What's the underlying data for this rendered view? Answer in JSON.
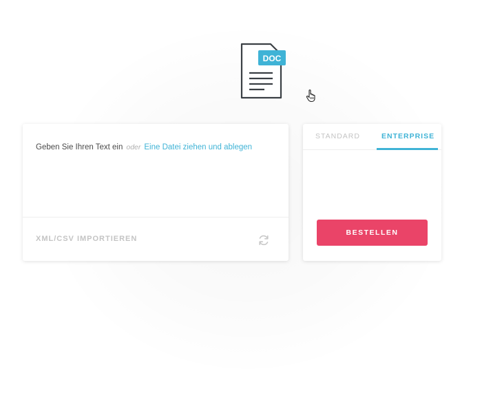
{
  "header": {
    "doc_icon": "document-icon",
    "doc_badge": "DOC"
  },
  "cursor": {
    "icon": "hand-pointer-icon"
  },
  "input_panel": {
    "prompt": "Geben Sie Ihren Text ein",
    "or": "oder",
    "drop_link": "Eine Datei ziehen und ablegen",
    "import_link": "XML/CSV IMPORTIEREN",
    "refresh_icon": "refresh-icon"
  },
  "plan_panel": {
    "tabs": [
      {
        "label": "STANDARD",
        "active": false
      },
      {
        "label": "ENTERPRISE",
        "active": true
      }
    ],
    "order_button": "BESTELLEN"
  },
  "colors": {
    "accent": "#3fb3d6",
    "button": "#ea4468",
    "icon_dark": "#3a3f44"
  }
}
